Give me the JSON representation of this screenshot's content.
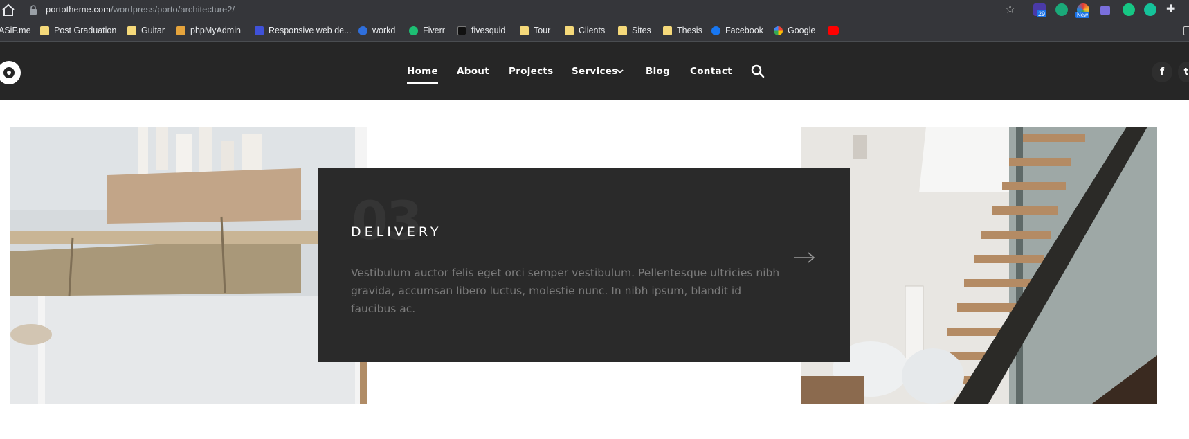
{
  "browser": {
    "url_host": "portotheme.com",
    "url_path": "/wordpress/porto/architecture2/",
    "extension_badges": {
      "first": "29",
      "third": "New"
    },
    "bookmarks": [
      "ASiF.me",
      "Post Graduation",
      "Guitar",
      "phpMyAdmin",
      "Responsive web de...",
      "workd",
      "Fiverr",
      "fivesquid",
      "Tour",
      "Clients",
      "Sites",
      "Thesis",
      "Facebook",
      "Google"
    ]
  },
  "nav": {
    "items": [
      "Home",
      "About",
      "Projects",
      "Services",
      "Blog",
      "Contact"
    ],
    "active": "Home"
  },
  "card": {
    "number": "03",
    "title": "DELIVERY",
    "description": "Vestibulum auctor felis eget orci semper vestibulum. Pellentesque ultricies nibh gravida, accumsan libero luctus, molestie nunc. In nibh ipsum, blandit id faucibus ac."
  },
  "icons": {
    "home": "home-icon",
    "lock": "lock-icon",
    "star": "bookmark-star-icon",
    "search": "search-icon",
    "facebook": "facebook-icon",
    "twitter": "twitter-icon",
    "arrow": "arrow-right-icon",
    "caret": "chevron-down-icon"
  },
  "colors": {
    "header_bg": "#262626",
    "card_bg": "#2a2a2a",
    "chrome_bg": "#35363a"
  }
}
